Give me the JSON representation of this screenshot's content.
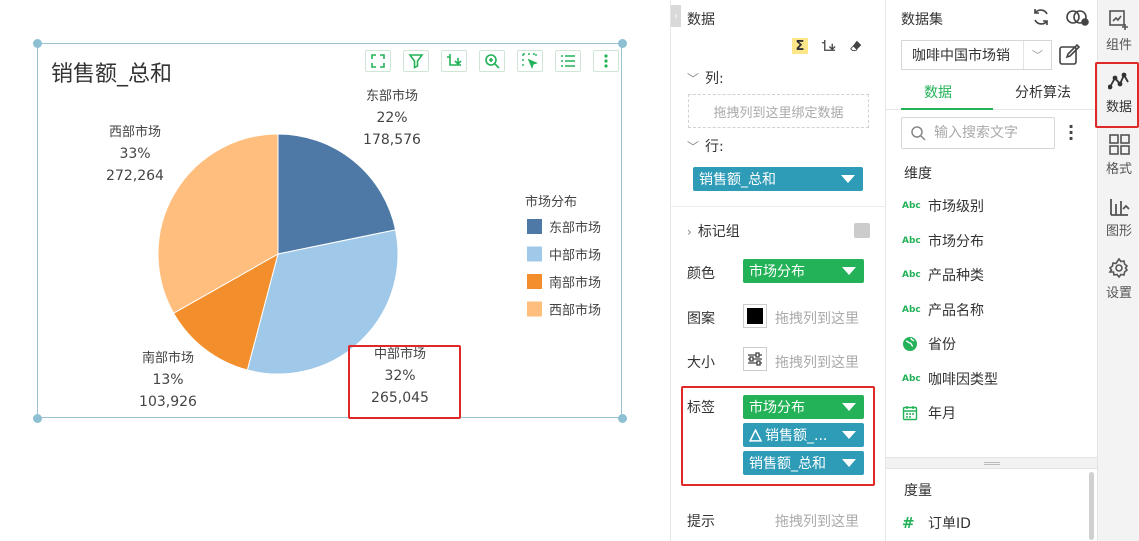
{
  "widget": {
    "title": "销售额_总和",
    "toolbar": [
      "expand-icon",
      "filter-icon",
      "drill-icon",
      "zoom-icon",
      "select-icon",
      "list-icon",
      "more-icon"
    ]
  },
  "chart_data": {
    "type": "pie",
    "legend_title": "市场分布",
    "legend_position": "right",
    "slices": [
      {
        "name": "东部市场",
        "percent": "22%",
        "value": 178576,
        "value_label": "178,576",
        "color": "#4e79a7"
      },
      {
        "name": "中部市场",
        "percent": "32%",
        "value": 265045,
        "value_label": "265,045",
        "color": "#a0c8e8"
      },
      {
        "name": "南部市场",
        "percent": "13%",
        "value": 103926,
        "value_label": "103,926",
        "color": "#f28e2b"
      },
      {
        "name": "西部市场",
        "percent": "33%",
        "value": 272264,
        "value_label": "272,264",
        "color": "#ffbe7d"
      }
    ]
  },
  "data_panel": {
    "title": "数据",
    "columns_label": "列:",
    "columns_placeholder": "拖拽列到这里绑定数据",
    "rows_label": "行:",
    "row_pill": "销售额_总和",
    "marks_label": "标记组",
    "color_label": "颜色",
    "color_pill": "市场分布",
    "pattern_label": "图案",
    "pattern_hint": "拖拽列到这里",
    "size_label": "大小",
    "size_hint": "拖拽列到这里",
    "label_label": "标签",
    "label_pills": [
      "市场分布",
      "销售额_...",
      "销售额_总和"
    ],
    "tooltip_label": "提示",
    "tooltip_hint": "拖拽列到这里"
  },
  "dataset_panel": {
    "title": "数据集",
    "dataset_value": "咖啡中国市场销",
    "tabs": [
      "数据",
      "分析算法"
    ],
    "search_placeholder": "输入搜索文字",
    "dimension_label": "维度",
    "dimensions": [
      {
        "name": "市场级别",
        "icon": "Abc"
      },
      {
        "name": "市场分布",
        "icon": "Abc"
      },
      {
        "name": "产品种类",
        "icon": "Abc"
      },
      {
        "name": "产品名称",
        "icon": "Abc"
      },
      {
        "name": "省份",
        "icon": "globe-icon"
      },
      {
        "name": "咖啡因类型",
        "icon": "Abc"
      },
      {
        "name": "年月",
        "icon": "calendar-icon"
      }
    ],
    "measure_label": "度量",
    "measures": [
      {
        "name": "订单ID",
        "icon": "#"
      }
    ]
  },
  "side_nav": {
    "items": [
      {
        "label": "组件",
        "icon": "component-icon"
      },
      {
        "label": "数据",
        "icon": "data-icon"
      },
      {
        "label": "格式",
        "icon": "format-icon"
      },
      {
        "label": "图形",
        "icon": "chart-icon"
      },
      {
        "label": "设置",
        "icon": "settings-icon"
      }
    ],
    "active": "数据"
  }
}
